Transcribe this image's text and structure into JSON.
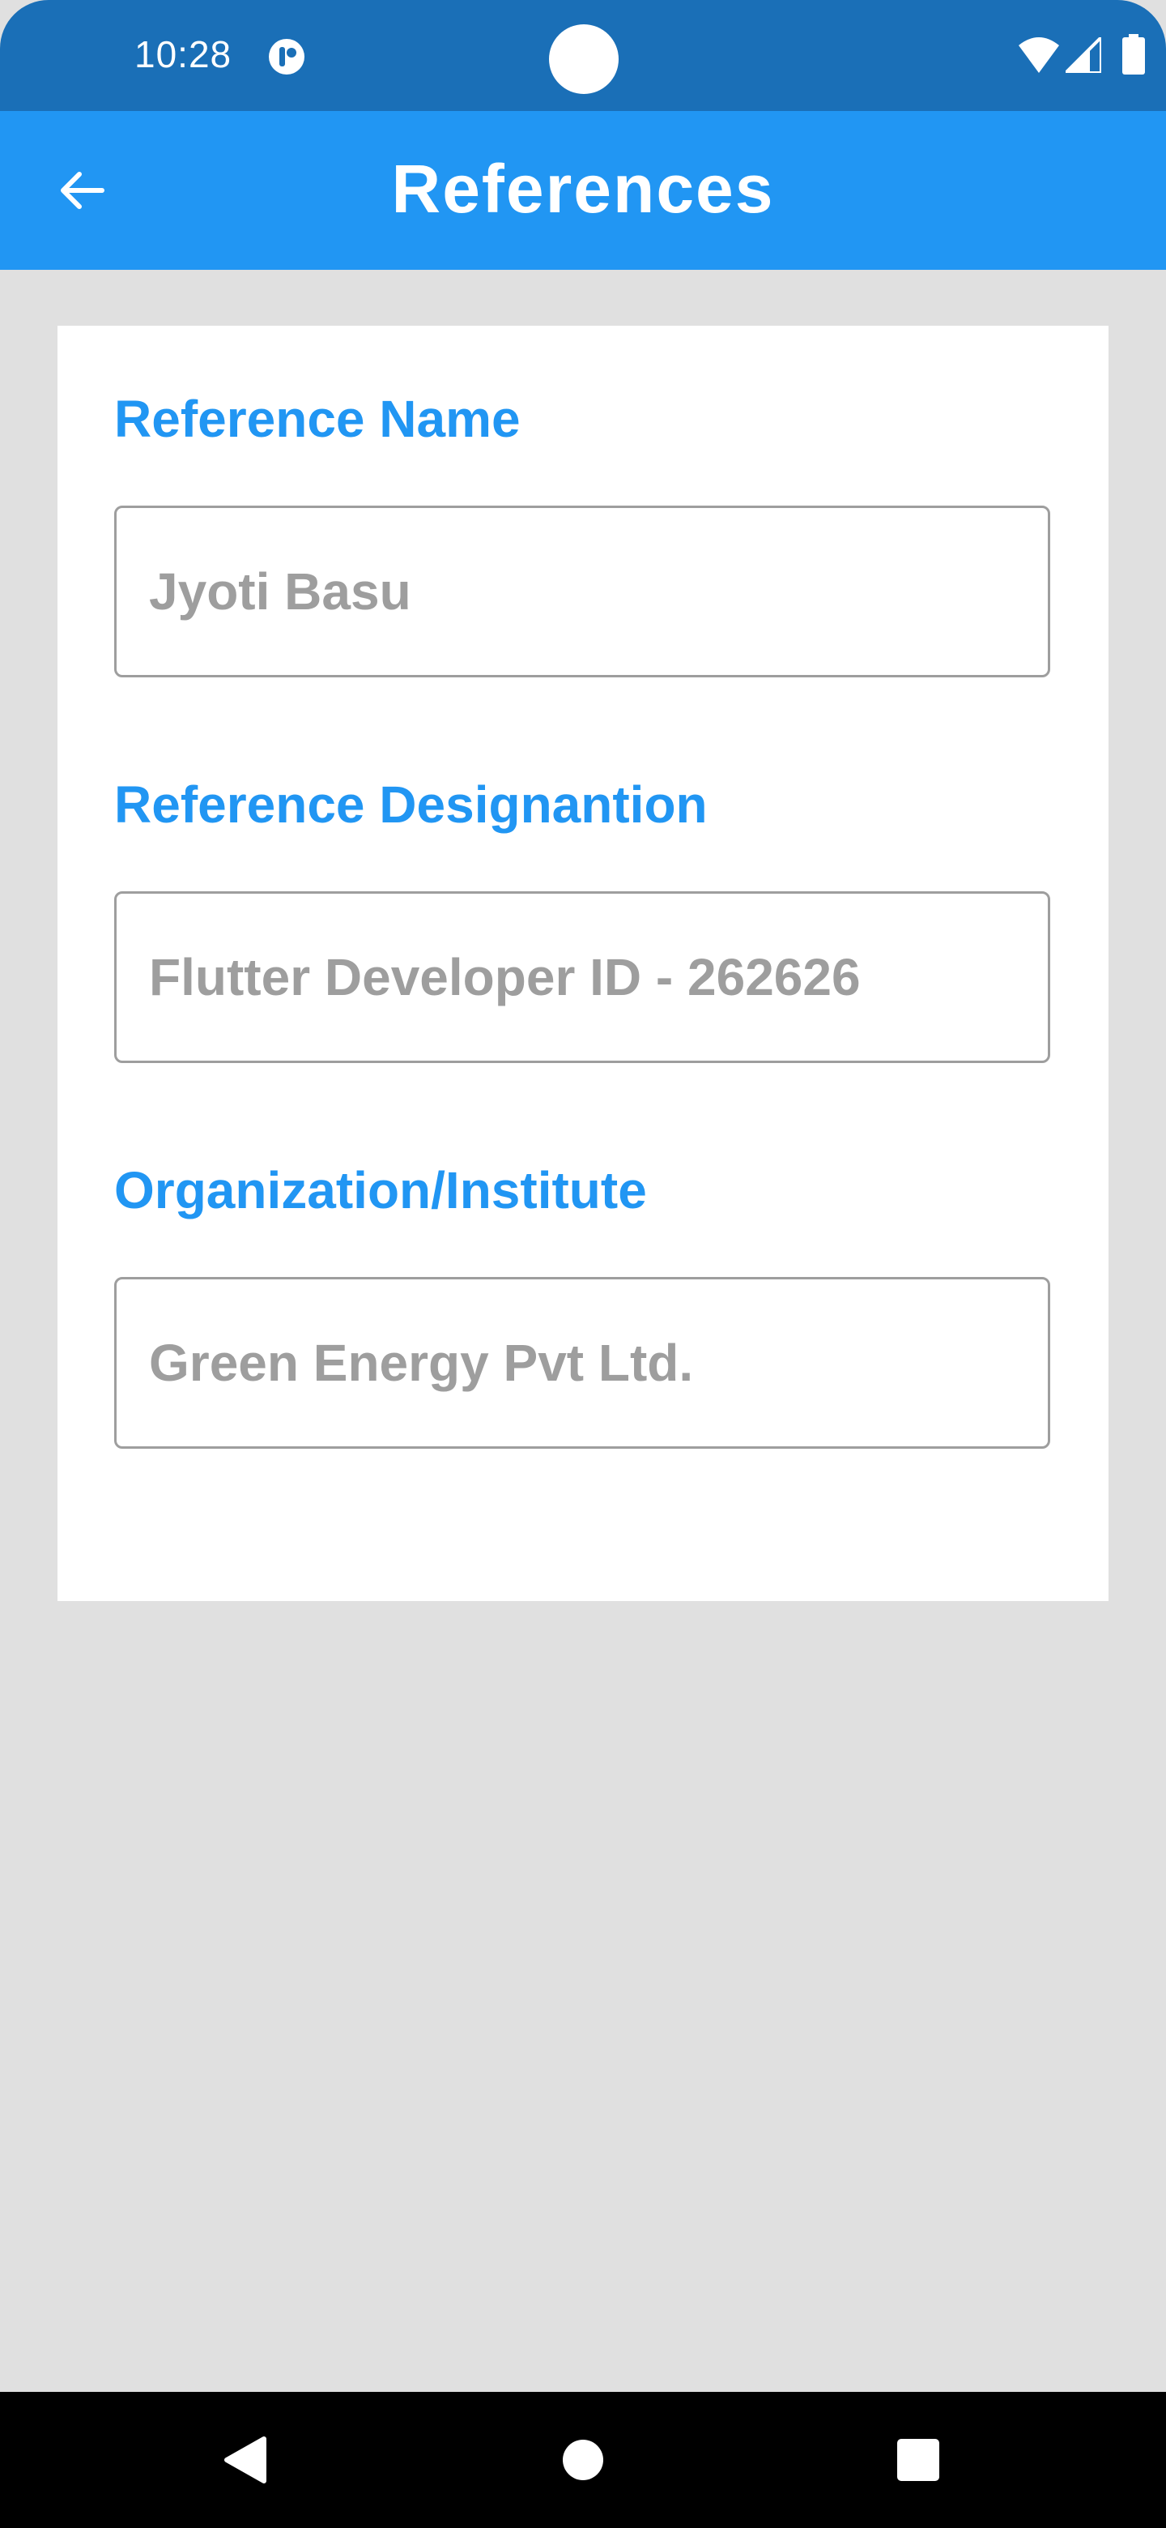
{
  "status_bar": {
    "time": "10:28",
    "icons": [
      "app-notification-icon",
      "wifi-icon",
      "cellular-signal-icon",
      "battery-icon"
    ]
  },
  "app_bar": {
    "title": "References",
    "back_icon": "arrow-left-icon"
  },
  "form": {
    "fields": [
      {
        "label": "Reference Name",
        "value": "Jyoti Basu"
      },
      {
        "label": "Reference Designantion",
        "value": "Flutter Developer ID - 262626"
      },
      {
        "label": "Organization/Institute",
        "value": "Green Energy Pvt Ltd."
      }
    ]
  },
  "nav_bar": {
    "icons": [
      "back-triangle-icon",
      "home-circle-icon",
      "recents-square-icon"
    ]
  },
  "colors": {
    "status_bar": "#1a6fb7",
    "app_bar": "#2196f3",
    "label": "#2196f3",
    "value_text": "#9e9e9e",
    "background": "#e0e0e0",
    "nav_bar": "#000000"
  }
}
